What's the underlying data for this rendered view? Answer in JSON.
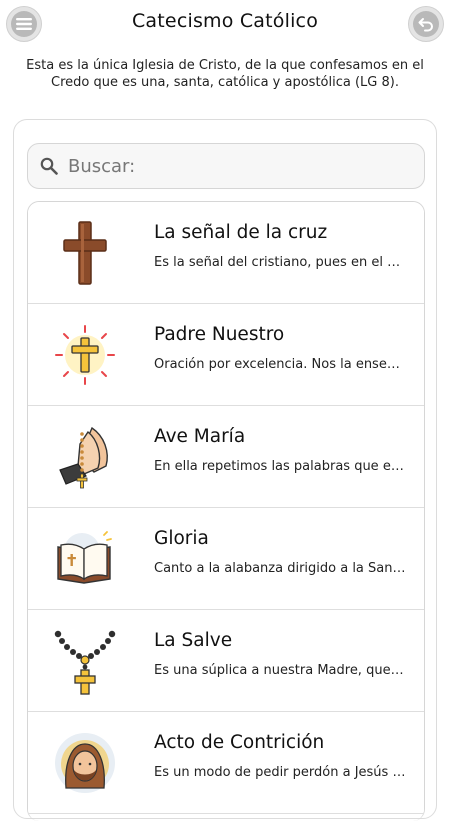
{
  "header": {
    "title": "Catecismo Católico",
    "menu_icon": "menu-icon",
    "back_icon": "back-arrow-icon"
  },
  "subtitle": "Esta es la única Iglesia de Cristo, de la que confesamos en el Credo que es una, santa, católica y apostólica (LG 8).",
  "search": {
    "placeholder": "Buscar:",
    "icon": "search-icon"
  },
  "items": [
    {
      "name": "La señal de la cruz",
      "desc": "Es la señal del cristiano, pues en el nombre de la Santísima Trinidad",
      "icon": "wooden-cross-icon"
    },
    {
      "name": "Padre Nuestro",
      "desc": "Oración por excelencia. Nos la enseñó el mismo Jesús",
      "icon": "shining-cross-icon"
    },
    {
      "name": "Ave María",
      "desc": "En ella repetimos las palabras que el ángel dijo a María",
      "icon": "praying-hands-rosary-icon"
    },
    {
      "name": "Gloria",
      "desc": "Canto a la alabanza dirigido a la Santísima Trinidad",
      "icon": "open-bible-icon"
    },
    {
      "name": "La Salve",
      "desc": "Es una súplica a nuestra Madre, que es Reina",
      "icon": "rosary-icon"
    },
    {
      "name": "Acto de Contrición",
      "desc": "Es un modo de pedir perdón a Jesús por nuestros pecados",
      "icon": "jesus-face-icon"
    }
  ],
  "colors": {
    "accent_wood": "#8a4b2a",
    "gold": "#f5c33b",
    "panel_border": "#dcdcdc"
  }
}
